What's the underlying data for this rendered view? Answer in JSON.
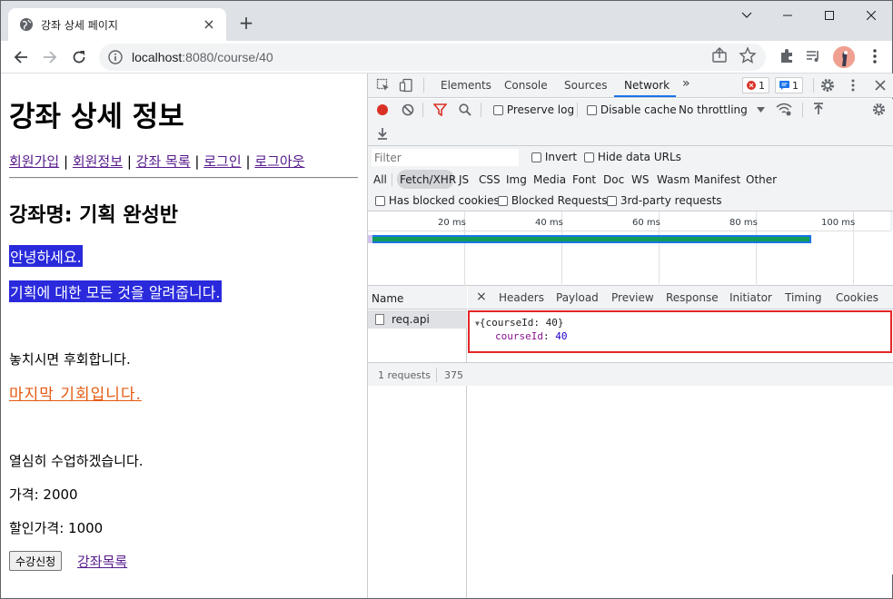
{
  "browser": {
    "tab_title": "강좌 상세 페이지",
    "new_tab": "+",
    "url_host": "localhost",
    "url_rest": ":8080/course/40"
  },
  "page": {
    "heading": "강좌 상세 정보",
    "nav": [
      "회원가입",
      "회원정보",
      "강좌 목록",
      "로그인",
      "로그아웃"
    ],
    "nav_sep": "|",
    "course_title": "강좌명: 기획 완성반",
    "greeting": "안녕하세요.",
    "description": "기획에 대한 모든 것을 알려줍니다.",
    "dont_miss": "놓치시면 후회합니다.",
    "last_chance": "마지막 기회입니다.",
    "study_hard": "열심히 수업하겠습니다.",
    "price": "가격: 2000",
    "discount_price": "할인가격: 1000",
    "enroll_button": "수강신청",
    "course_list_link": "강좌목록"
  },
  "devtools": {
    "tabs": [
      "Elements",
      "Console",
      "Sources",
      "Network"
    ],
    "active_tab": "Network",
    "more_tabs": "»",
    "error_count": "1",
    "message_count": "1",
    "toolbar": {
      "preserve_log": "Preserve log",
      "disable_cache": "Disable cache",
      "throttling": "No throttling"
    },
    "filter": {
      "placeholder": "Filter",
      "invert": "Invert",
      "hide_data_urls": "Hide data URLs",
      "types": [
        "All",
        "Fetch/XHR",
        "JS",
        "CSS",
        "Img",
        "Media",
        "Font",
        "Doc",
        "WS",
        "Wasm",
        "Manifest",
        "Other"
      ],
      "active_type": "Fetch/XHR",
      "has_blocked_cookies": "Has blocked cookies",
      "blocked_requests": "Blocked Requests",
      "third_party": "3rd-party requests"
    },
    "timeline_ticks": [
      "20 ms",
      "40 ms",
      "60 ms",
      "80 ms",
      "100 ms"
    ],
    "list": {
      "name_header": "Name",
      "rows": [
        "req.api"
      ],
      "footer_requests": "1 requests",
      "footer_size": "375"
    },
    "detail": {
      "close": "×",
      "tabs": [
        "Headers",
        "Payload",
        "Preview",
        "Response",
        "Initiator",
        "Timing",
        "Cookies"
      ],
      "json_root": "{courseId: 40}",
      "json_key": "courseId",
      "json_value": "40"
    }
  }
}
